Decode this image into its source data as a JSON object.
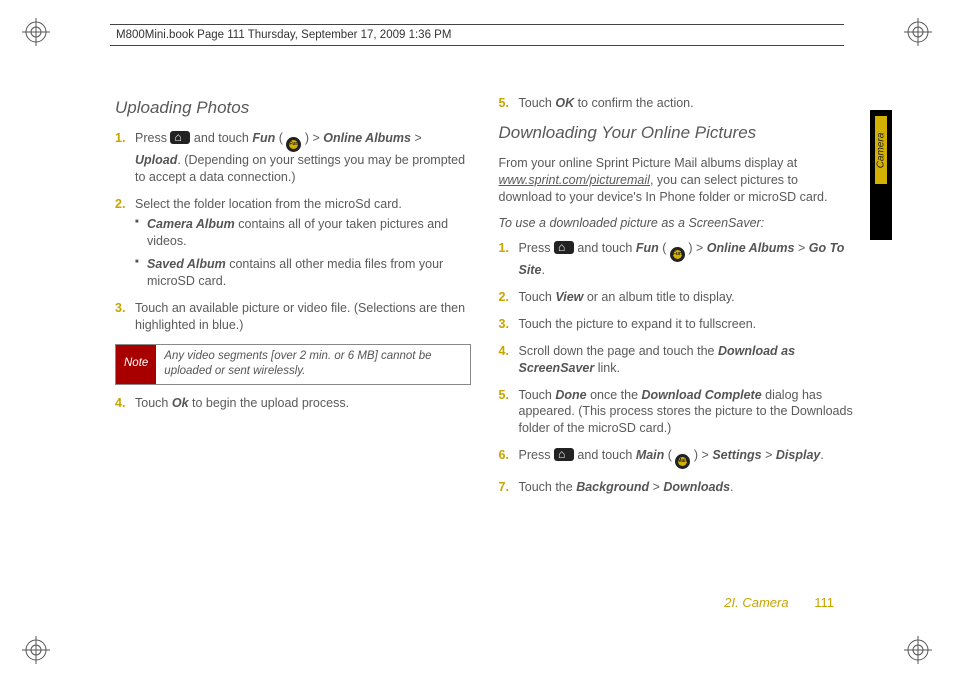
{
  "header": "M800Mini.book  Page 111  Thursday, September 17, 2009  1:36 PM",
  "sideTab": "Camera",
  "left": {
    "h": "Uploading Photos",
    "s1a": "Press ",
    "s1b": " and touch ",
    "s1fun": "Fun",
    "s1c": " ( ",
    "s1d": " ) > ",
    "s1oa": "Online Albums",
    "s1e": " > ",
    "s1up": "Upload",
    "s1f": ". (Depending on your settings you may be prompted to accept a data connection.)",
    "s2": "Select the folder location from the microSd card.",
    "s2a_b": "Camera Album",
    "s2a_t": " contains all of your taken pictures and videos.",
    "s2b_b": "Saved Album",
    "s2b_t": " contains all other media files from your microSD card.",
    "s3": "Touch an available picture or video file. (Selections are then highlighted in blue.)",
    "noteLabel": "Note",
    "noteText": "Any video segments [over 2 min. or 6 MB] cannot be uploaded or sent wirelessly.",
    "s4a": "Touch ",
    "s4ok": "Ok",
    "s4b": " to begin the upload process."
  },
  "right": {
    "s5a": "Touch ",
    "s5ok": "OK",
    "s5b": " to confirm the action.",
    "h": "Downloading Your Online Pictures",
    "intro1": "From your online Sprint Picture Mail albums display at ",
    "introUrl": "www.sprint.com/picturemail",
    "intro2": ", you can select pictures to download to your device's In Phone folder or microSD card.",
    "lead": "To use a downloaded picture as a ScreenSaver:",
    "r1a": "Press ",
    "r1b": " and touch ",
    "r1fun": "Fun",
    "r1c": " ( ",
    "r1d": " ) > ",
    "r1oa": "Online Albums",
    "r1e": " > ",
    "r1gs": "Go To Site",
    "r1f": ".",
    "r2a": "Touch ",
    "r2v": "View",
    "r2b": " or an album title to display.",
    "r3": "Touch the picture to expand it to fullscreen.",
    "r4a": "Scroll down the page and touch the ",
    "r4dl": "Download as ScreenSaver",
    "r4b": " link.",
    "r5a": "Touch ",
    "r5d": "Done",
    "r5b": " once the ",
    "r5dc": "Download Complete",
    "r5c": " dialog has appeared. (This process stores the picture to the Downloads folder of the microSD card.)",
    "r6a": "Press ",
    "r6b": " and touch ",
    "r6m": "Main",
    "r6c": " ( ",
    "r6d": " ) > ",
    "r6s": "Settings",
    "r6e": " > ",
    "r6dp": "Display",
    "r6f": ".",
    "r7a": "Touch the ",
    "r7bg": "Background",
    "r7b": " > ",
    "r7dl": "Downloads",
    "r7c": "."
  },
  "footer": {
    "section": "2I. Camera",
    "page": "111"
  },
  "iconLabels": {
    "fun": "Fun",
    "main": "Main"
  }
}
